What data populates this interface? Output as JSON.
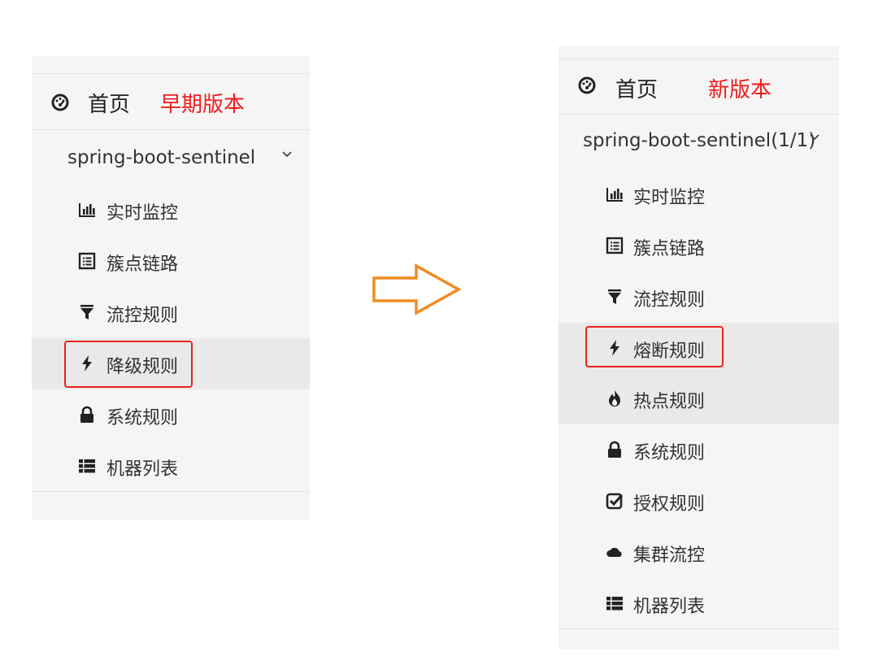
{
  "left": {
    "home_label": "首页",
    "version_label": "早期版本",
    "app": {
      "name": "spring-boot-sentinel"
    },
    "menu": [
      {
        "label": "实时监控",
        "icon": "bar-chart-icon"
      },
      {
        "label": "簇点链路",
        "icon": "list-alt-icon"
      },
      {
        "label": "流控规则",
        "icon": "filter-icon"
      },
      {
        "label": "降级规则",
        "icon": "flash-icon",
        "active": true,
        "highlighted": true
      },
      {
        "label": "系统规则",
        "icon": "lock-icon"
      },
      {
        "label": "机器列表",
        "icon": "th-list-icon"
      }
    ]
  },
  "right": {
    "home_label": "首页",
    "version_label": "新版本",
    "app": {
      "name": "spring-boot-sentinel",
      "count": "(1/1)"
    },
    "menu": [
      {
        "label": "实时监控",
        "icon": "bar-chart-icon"
      },
      {
        "label": "簇点链路",
        "icon": "list-alt-icon"
      },
      {
        "label": "流控规则",
        "icon": "filter-icon"
      },
      {
        "label": "熔断规则",
        "icon": "flash-icon",
        "active": true,
        "highlighted": true
      },
      {
        "label": "热点规则",
        "icon": "fire-icon",
        "active": true
      },
      {
        "label": "系统规则",
        "icon": "lock-icon"
      },
      {
        "label": "授权规则",
        "icon": "check-icon"
      },
      {
        "label": "集群流控",
        "icon": "cloud-icon"
      },
      {
        "label": "机器列表",
        "icon": "th-list-icon"
      }
    ]
  },
  "colors": {
    "version_red": "#f01d1d",
    "highlight_red": "#e8231f",
    "arrow_orange": "#f08a24",
    "panel_bg": "#f5f5f5",
    "active_bg": "#e9e9e9"
  }
}
